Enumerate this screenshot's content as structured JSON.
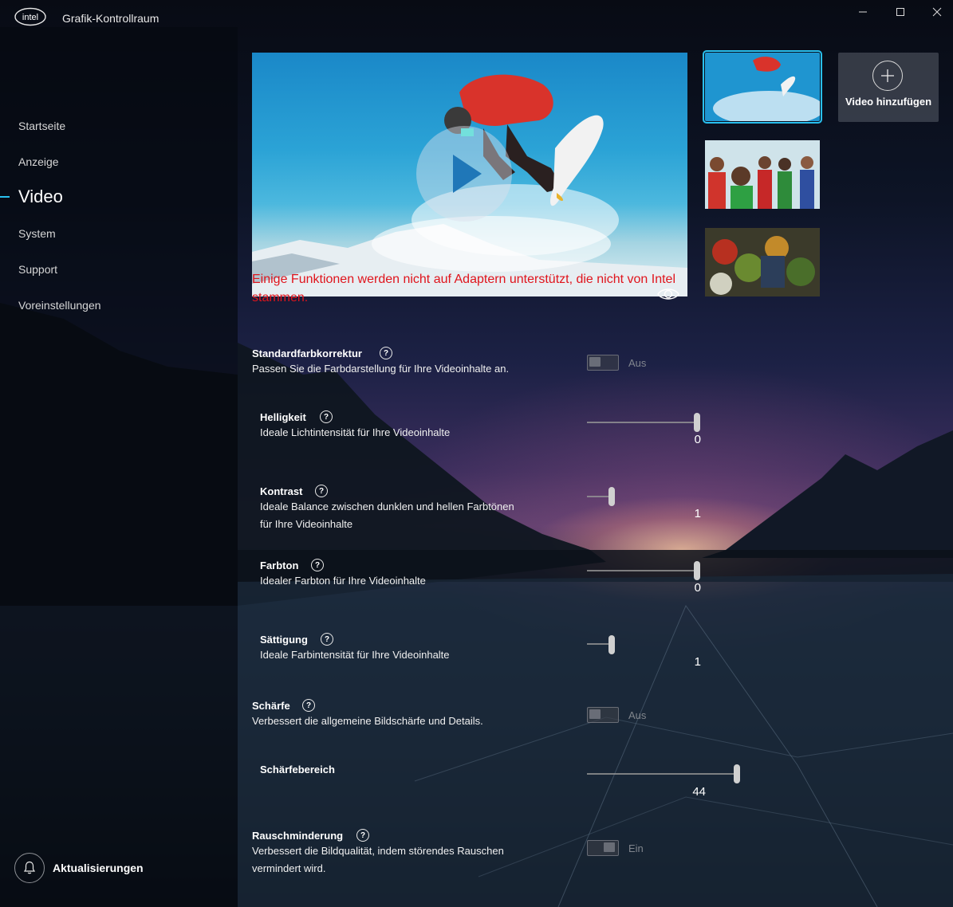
{
  "app": {
    "brand": "intel",
    "title": "Grafik-Kontrollraum"
  },
  "window_controls": {
    "minimize": "—",
    "maximize": "☐",
    "close": "✕"
  },
  "nav": {
    "items": [
      {
        "label": "Startseite",
        "active": false
      },
      {
        "label": "Anzeige",
        "active": false
      },
      {
        "label": "Video",
        "active": true
      },
      {
        "label": "System",
        "active": false
      },
      {
        "label": "Support",
        "active": false
      },
      {
        "label": "Voreinstellungen",
        "active": false
      }
    ]
  },
  "updates": {
    "label": "Aktualisierungen",
    "icon": "bell-icon"
  },
  "preview": {
    "warning": "Einige Funktionen werden nicht auf Adaptern unterstützt, die nicht von Intel stammen.",
    "play_icon": "play-icon",
    "compare_icon": "eye-icon"
  },
  "thumbnails": [
    {
      "name": "snowboarder",
      "selected": true
    },
    {
      "name": "group-of-people",
      "selected": false
    },
    {
      "name": "market-vegetables",
      "selected": false
    }
  ],
  "add_video": {
    "label": "Video hinzufügen",
    "icon": "plus-icon"
  },
  "accent_color": "#29c0ef",
  "warning_color": "#e0141c",
  "settings": {
    "standardfarbkorrektur": {
      "title": "Standardfarbkorrektur",
      "desc": "Passen Sie die Farbdarstellung für Ihre Videoinhalte an.",
      "state": "Aus"
    },
    "helligkeit": {
      "title": "Helligkeit",
      "desc": "Ideale Lichtintensität für Ihre Videoinhalte",
      "value": "0"
    },
    "kontrast": {
      "title": "Kontrast",
      "desc1": "Ideale Balance zwischen dunklen und hellen Farbtönen",
      "desc2": "für Ihre Videoinhalte",
      "value": "1"
    },
    "farbton": {
      "title": "Farbton",
      "desc": "Idealer Farbton für Ihre Videoinhalte",
      "value": "0"
    },
    "saettigung": {
      "title": "Sättigung",
      "desc": "Ideale Farbintensität für Ihre Videoinhalte",
      "value": "1"
    },
    "schaerfe": {
      "title": "Schärfe",
      "desc": "Verbessert die allgemeine Bildschärfe und Details.",
      "state": "Aus"
    },
    "schaerfebereich": {
      "title": "Schärfebereich",
      "value": "44"
    },
    "rauschminderung": {
      "title": "Rauschminderung",
      "desc1": "Verbessert die Bildqualität, indem störendes Rauschen",
      "desc2": "vermindert wird.",
      "state": "Ein"
    }
  },
  "help_symbol": "?"
}
